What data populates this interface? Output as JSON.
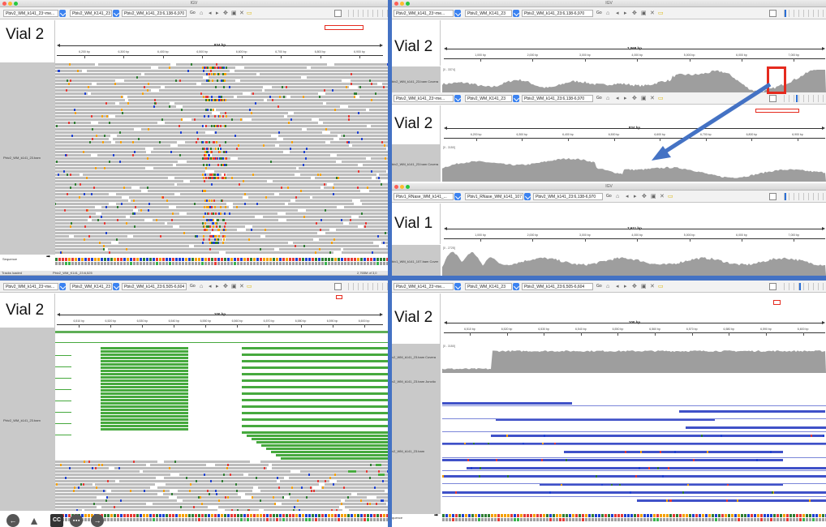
{
  "app_title": "IGV",
  "vial_labels": {
    "tl": "Vial 2",
    "tr_top": "Vial 2",
    "tr_mid": "Vial 2",
    "tr_vial1": "Vial 1",
    "bl": "Vial 2",
    "br": "Vial 2"
  },
  "toolbar_tl": {
    "genome": "Pbiv2_WM_k141_23~me...",
    "chrom": "Pbiv2_WM_K141_23",
    "locus": "Pbiv2_WM_k141_23:6,138-6,970",
    "go": "Go"
  },
  "toolbar_tr": {
    "genome": "Pbiv2_WM_k141_23~me...",
    "chrom": "Pbiv2_WM_K141_23",
    "locus": "Pbiv2_WM_k141_23:6,138-6,970",
    "go": "Go"
  },
  "toolbar_trmid": {
    "genome": "Pbiv2_WM_k141_23~me...",
    "chrom": "Pbiv2_WM_K141_23",
    "locus": "Pbiv2_WM_k141_23:6,138-6,970",
    "go": "Go"
  },
  "toolbar_v1": {
    "genome": "Pbiv1_RNase_WM_k141_...",
    "chrom": "Pbiv1_RNase_WM_k141_107",
    "locus": "Pbiv2_WM_k141_23:6,138-6,970",
    "go": "Go"
  },
  "toolbar_bl": {
    "genome": "Pbiv2_WM_k141_23~me...",
    "chrom": "Pbiv2_WM_K141_23",
    "locus": "Pbiv2_WM_k141_23:6,505-6,604",
    "go": "Go"
  },
  "toolbar_br": {
    "genome": "Pbiv2_WM_k141_23~me...",
    "chrom": "Pbiv2_WM_K141_23",
    "locus": "Pbiv2_WM_k141_23:6,505-6,604",
    "go": "Go"
  },
  "rulers": {
    "tl": {
      "span": "834 bp",
      "ticks": [
        "6,200 bp",
        "6,300 bp",
        "6,400 bp",
        "6,500 bp",
        "6,600 bp",
        "6,700 bp",
        "6,800 bp",
        "6,900 bp"
      ]
    },
    "tr_top": {
      "span": "7,068 bp",
      "ticks": [
        "1,000 bp",
        "2,000 bp",
        "3,000 bp",
        "4,000 bp",
        "5,000 bp",
        "6,000 bp",
        "7,000 bp"
      ]
    },
    "tr_mid": {
      "span": "834 bp",
      "ticks": [
        "6,200 bp",
        "6,300 bp",
        "6,400 bp",
        "6,500 bp",
        "6,600 bp",
        "6,700 bp",
        "6,800 bp",
        "6,900 bp"
      ]
    },
    "v1": {
      "span": "7,611 bp",
      "ticks": [
        "1,000 bp",
        "2,000 bp",
        "3,000 bp",
        "4,000 bp",
        "5,000 bp",
        "6,000 bp",
        "7,000 bp"
      ]
    },
    "bl": {
      "span": "100 bp",
      "ticks": [
        "6,510 bp",
        "6,520 bp",
        "6,530 bp",
        "6,540 bp",
        "6,550 bp",
        "6,560 bp",
        "6,570 bp",
        "6,580 bp",
        "6,590 bp",
        "6,600 bp"
      ]
    },
    "br": {
      "span": "100 bp",
      "ticks": [
        "6,510 bp",
        "6,520 bp",
        "6,530 bp",
        "6,540 bp",
        "6,550 bp",
        "6,560 bp",
        "6,570 bp",
        "6,580 bp",
        "6,590 bp",
        "6,600 bp"
      ]
    }
  },
  "track_names": {
    "tl_bam": "Pbiv2_WM_k141_23.bam",
    "tl_seq": "Sequence",
    "tr_cov": "biv2_WM_k141_23.bam Covera",
    "trmid_cov": "biv2_WM_k141_23.bam Covera",
    "v1_cov": "biv1_WM_k141_107.bam Cover",
    "bl_bam": "Pbiv2_WM_k141_23.bam",
    "br_cov": "v2_WM_k141_23.bam Covera",
    "br_junc": "v2_WM_k141_23.bam Junctio",
    "br_bam": "v2_WM_k141_23.bam",
    "br_seq": "quence"
  },
  "cov_ranges": {
    "tr": "[0 - 3374]",
    "trmid": "[0 - 3150]",
    "v1": "[0 - 2725]",
    "br": "[0 - 3150]"
  },
  "status_bl": "Tracks loaded",
  "status_bl_pos": "Pbiv2_WM_K141_23:6,525",
  "status_bl_mem": "2,765M of 3,0",
  "bottom_icons": [
    "back-icon",
    "person-icon",
    "cc-icon",
    "more-icon",
    "forward-icon"
  ],
  "colors": {
    "divider": "#4472c4",
    "arrow": "#4472c4",
    "redbox": "#e52a1e",
    "read_grey": "#bdbdbd",
    "read_green": "#46a93e",
    "read_blue": "#3f51c8",
    "coverage": "#9e9e9e"
  }
}
